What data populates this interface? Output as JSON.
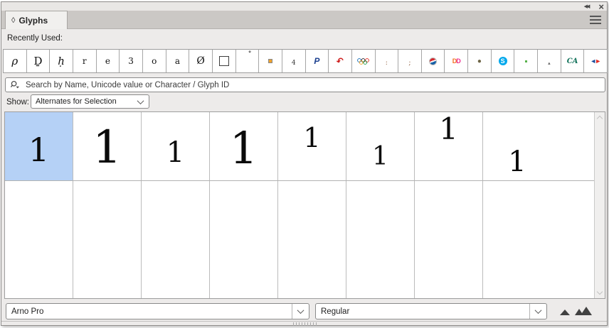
{
  "panel": {
    "title": "Glyphs",
    "tab_icon": "◊",
    "collapse_icon": "◀◀",
    "close_icon": "×"
  },
  "recently_used": {
    "label": "Recently Used:",
    "glyphs": [
      {
        "name": "glyph-rho",
        "kind": "text",
        "char": "ρ",
        "cls": "gserif it",
        "size": 15
      },
      {
        "name": "glyph-D-underbar",
        "kind": "text",
        "char": "Ḏ",
        "cls": "gserif",
        "size": 15
      },
      {
        "name": "glyph-h-dotbelow",
        "kind": "text",
        "char": "ḥ",
        "cls": "gserif it",
        "size": 15
      },
      {
        "name": "glyph-r",
        "kind": "text",
        "char": "r",
        "cls": "gserif",
        "size": 12
      },
      {
        "name": "glyph-e",
        "kind": "text",
        "char": "e",
        "cls": "gserif",
        "size": 12
      },
      {
        "name": "glyph-three",
        "kind": "text",
        "char": "3",
        "cls": "gserif",
        "size": 12
      },
      {
        "name": "glyph-o",
        "kind": "text",
        "char": "o",
        "cls": "gserif",
        "size": 12
      },
      {
        "name": "glyph-a",
        "kind": "text",
        "char": "a",
        "cls": "gserif",
        "size": 12
      },
      {
        "name": "glyph-o-slash",
        "kind": "text",
        "char": "Ø",
        "cls": "gserif",
        "size": 14
      },
      {
        "name": "glyph-white-square",
        "kind": "square"
      },
      {
        "name": "glyph-ring-above",
        "kind": "text",
        "char": "˚",
        "cls": "k-ring",
        "size": 12
      },
      {
        "name": "glyph-orange-square",
        "kind": "osq"
      },
      {
        "name": "glyph-four-inferior",
        "kind": "text",
        "char": "4",
        "cls": "gserif k-small",
        "size": 9
      },
      {
        "name": "glyph-paypal-logo",
        "kind": "text",
        "char": "P",
        "cls": "k-paypal",
        "size": 12
      },
      {
        "name": "glyph-red-swash",
        "kind": "text",
        "char": "↶",
        "cls": "k-redcurve",
        "size": 12
      },
      {
        "name": "glyph-olympic-rings",
        "kind": "olympic"
      },
      {
        "name": "glyph-colon",
        "kind": "text",
        "char": ":",
        "cls": "k-punct",
        "size": 10
      },
      {
        "name": "glyph-semicolon",
        "kind": "text",
        "char": ";",
        "cls": "k-punct",
        "size": 10
      },
      {
        "name": "glyph-pepsi-logo",
        "kind": "pepsi"
      },
      {
        "name": "glyph-dunkin-logo",
        "kind": "dunkin",
        "chars": [
          "D",
          "D"
        ]
      },
      {
        "name": "glyph-shell-mark",
        "kind": "text",
        "char": "●",
        "cls": "k-shell",
        "size": 10
      },
      {
        "name": "glyph-skype-logo",
        "kind": "skype",
        "char": "S"
      },
      {
        "name": "glyph-green-dot",
        "kind": "greendot"
      },
      {
        "name": "glyph-small-mark",
        "kind": "text",
        "char": "▴",
        "cls": "k-mark",
        "size": 7
      },
      {
        "name": "glyph-credit-agricole",
        "kind": "text",
        "char": "CA",
        "cls": "k-ca",
        "size": 10
      },
      {
        "name": "glyph-carrefour-logo",
        "kind": "carrefour",
        "chars": [
          "◄",
          "►"
        ]
      }
    ]
  },
  "search": {
    "placeholder": "Search by Name, Unicode value or Character / Glyph ID"
  },
  "show": {
    "label": "Show:",
    "value": "Alternates for Selection"
  },
  "glyph_grid": {
    "cells": [
      {
        "char": "1",
        "variant": "oldstyle",
        "selected": true
      },
      {
        "char": "1",
        "variant": "lining-large",
        "selected": false
      },
      {
        "char": "1",
        "variant": "oldstyle-small",
        "selected": false
      },
      {
        "char": "1",
        "variant": "lining",
        "selected": false
      },
      {
        "char": "1",
        "variant": "numerator",
        "selected": false
      },
      {
        "char": "1",
        "variant": "denominator",
        "selected": false
      },
      {
        "char": "1",
        "variant": "superscript",
        "selected": false
      },
      {
        "char": "1",
        "variant": "subscript",
        "selected": false
      }
    ],
    "empty_row_cells": 8
  },
  "footer": {
    "font_name": "Arno Pro",
    "font_style": "Regular"
  },
  "colors": {
    "selected_cell": "#b5d1f6",
    "panel_bg": "#edebea",
    "tabbar_bg": "#cbc8c5",
    "active_tab_bg": "#f1f0ee"
  }
}
